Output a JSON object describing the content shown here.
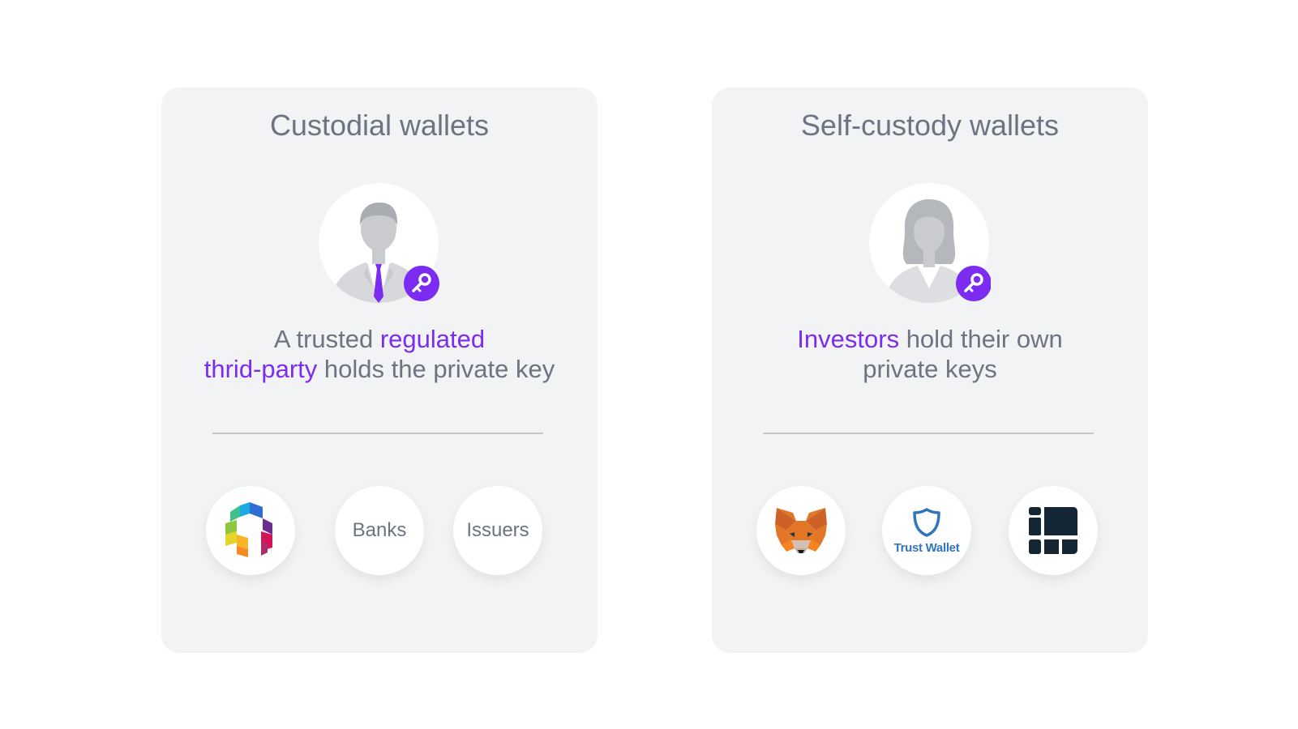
{
  "custodial": {
    "title": "Custodial wallets",
    "description": {
      "part1": "A trusted ",
      "highlight1": "regulated",
      "highlight2": "thrid-party",
      "part2": " holds the private key"
    },
    "logos": [
      {
        "type": "icon",
        "icon": "multicolor-cube-logo-icon"
      },
      {
        "type": "text",
        "label": "Banks"
      },
      {
        "type": "text",
        "label": "Issuers"
      }
    ]
  },
  "self_custody": {
    "title": "Self-custody wallets",
    "description": {
      "highlight": "Investors",
      "part1": " hold their own",
      "part2": "private keys"
    },
    "logos": [
      {
        "type": "icon",
        "icon": "metamask-fox-icon"
      },
      {
        "type": "icon",
        "icon": "trust-wallet-shield-icon",
        "label": "Trust Wallet"
      },
      {
        "type": "icon",
        "icon": "ledger-icon"
      }
    ]
  },
  "colors": {
    "accent": "#7b2cf0",
    "text": "#6b7480",
    "card_bg": "#f2f3f5"
  }
}
